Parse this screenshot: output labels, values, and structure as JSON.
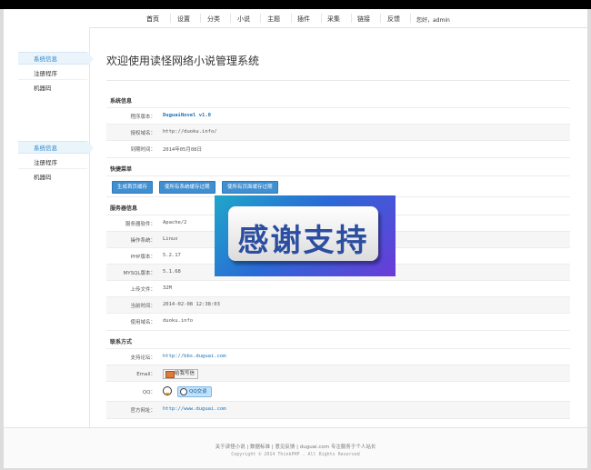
{
  "nav": {
    "items": [
      "首页",
      "设置",
      "分类",
      "小说",
      "主题",
      "插件",
      "采集",
      "链接",
      "反馈"
    ],
    "greeting": "您好，admin"
  },
  "sidebar": {
    "group1": [
      "系统信息",
      "注册程序",
      "机器码"
    ],
    "group2": [
      "系统信息",
      "注册程序",
      "机器码"
    ]
  },
  "main": {
    "title": "欢迎使用读怪网络小说管理系统",
    "sections": {
      "system": "系统信息",
      "quick": "快捷菜单",
      "server": "服务器信息",
      "contact": "联系方式"
    },
    "system_rows": [
      {
        "label": "程序版本：",
        "value": "DuguaiNovel v1.0"
      },
      {
        "label": "授权域名：",
        "value": "http://duoku.info/"
      },
      {
        "label": "到期时间：",
        "value": "2014年05月08日"
      }
    ],
    "quick_buttons": [
      "生成首页缓存",
      "使所有系统缓存过期",
      "使所有页面缓存过期"
    ],
    "server_rows": [
      {
        "label": "服务器软件：",
        "value": "Apache/2"
      },
      {
        "label": "操作系统：",
        "value": "Linux"
      },
      {
        "label": "PHP版本：",
        "value": "5.2.17"
      },
      {
        "label": "MYSQL版本：",
        "value": "5.1.68"
      },
      {
        "label": "上传文件：",
        "value": "32M"
      },
      {
        "label": "当前时间：",
        "value": "2014-02-08 12:38:03"
      },
      {
        "label": "使用域名：",
        "value": "duoku.info"
      }
    ],
    "contact_rows": {
      "forum_label": "支持论坛：",
      "forum_value": "http://bbs.duguai.com",
      "email_label": "Email：",
      "email_badge": "给我写信",
      "qq_label": "QQ：",
      "qq_badge": "QQ交谈",
      "site_label": "官方网址：",
      "site_value": "http://www.duguai.com"
    }
  },
  "overlay": {
    "text": "感谢支持"
  },
  "footer": {
    "links": "关于读怪小说 | 数据标准 | 意见反馈 | duguai.com 专注服务于个人站长",
    "copyright": "Copyright © 2014 ThinkPHP . All Rights Reserved"
  }
}
